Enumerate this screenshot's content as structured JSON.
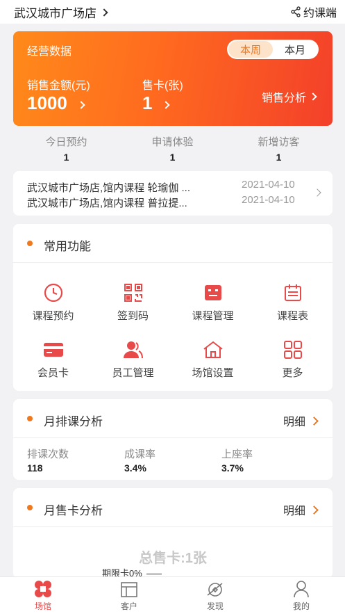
{
  "header": {
    "store_name": "武汉城市广场店",
    "share_label": "约课端"
  },
  "business": {
    "title": "经营数据",
    "period_tabs": [
      "本周",
      "本月"
    ],
    "active_period": "本周",
    "sales_amount_label": "销售金额(元)",
    "sales_amount_value": "1000",
    "cards_sold_label": "售卡(张)",
    "cards_sold_value": "1",
    "analysis_link": "销售分析"
  },
  "daily_stats": [
    {
      "label": "今日预约",
      "value": "1"
    },
    {
      "label": "申请体验",
      "value": "1"
    },
    {
      "label": "新增访客",
      "value": "1"
    }
  ],
  "notices": [
    {
      "text": "武汉城市广场店,馆内课程 轮瑜伽 ...",
      "date": "2021-04-10"
    },
    {
      "text": "武汉城市广场店,馆内课程 普拉提...",
      "date": "2021-04-10"
    }
  ],
  "common_functions": {
    "title": "常用功能",
    "items": [
      {
        "label": "课程预约",
        "icon": "clock-icon"
      },
      {
        "label": "签到码",
        "icon": "qr-code-icon"
      },
      {
        "label": "课程管理",
        "icon": "course-manage-icon"
      },
      {
        "label": "课程表",
        "icon": "calendar-icon"
      },
      {
        "label": "会员卡",
        "icon": "member-card-icon"
      },
      {
        "label": "员工管理",
        "icon": "staff-icon"
      },
      {
        "label": "场馆设置",
        "icon": "venue-home-icon"
      },
      {
        "label": "更多",
        "icon": "grid-more-icon"
      }
    ]
  },
  "monthly_schedule": {
    "title": "月排课分析",
    "detail_label": "明细",
    "stats": [
      {
        "label": "排课次数",
        "value": "118"
      },
      {
        "label": "成课率",
        "value": "3.4%"
      },
      {
        "label": "上座率",
        "value": "3.7%"
      }
    ]
  },
  "monthly_cards": {
    "title": "月售卡分析",
    "detail_label": "明细",
    "total_label": "总售卡:1张",
    "legend_term": "期限卡0%"
  },
  "tabbar": {
    "active": "场馆",
    "items": [
      {
        "label": "场馆",
        "icon": "venue-tab-icon"
      },
      {
        "label": "客户",
        "icon": "customer-tab-icon"
      },
      {
        "label": "发现",
        "icon": "discover-tab-icon"
      },
      {
        "label": "我的",
        "icon": "profile-tab-icon"
      }
    ]
  },
  "colors": {
    "accent": "#f0791f",
    "icon_red": "#e84a4a",
    "gradient_start": "#ff8a1a",
    "gradient_end": "#f3402a"
  }
}
